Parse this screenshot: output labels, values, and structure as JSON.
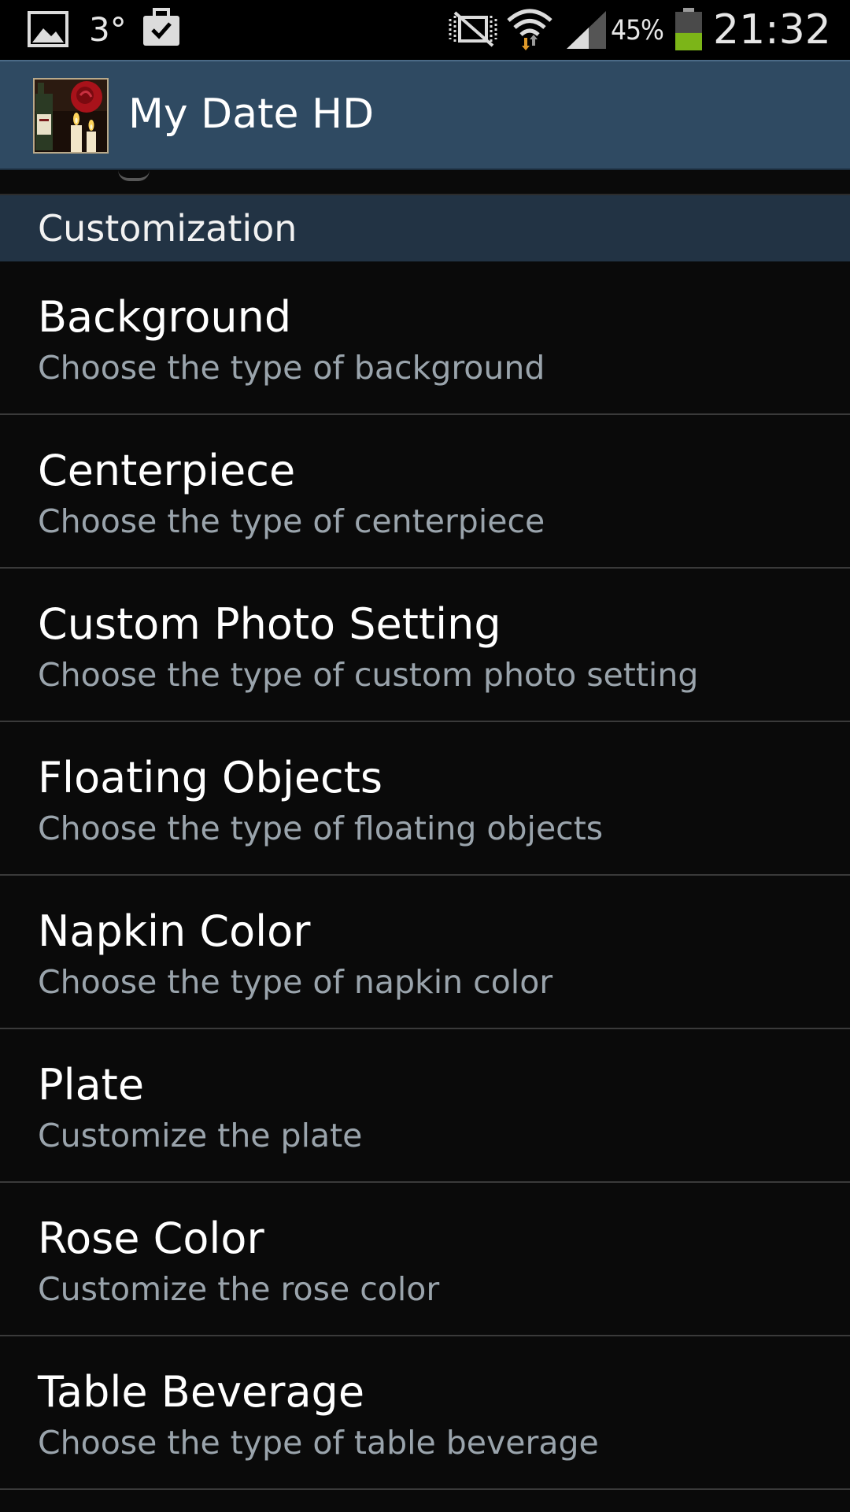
{
  "status_bar": {
    "temperature": "3°",
    "battery_percent": "45%",
    "battery_level": 0.45,
    "time": "21:32",
    "icons": [
      "gallery-icon",
      "briefcase-check-icon",
      "nfc-muted-icon",
      "wifi-icon",
      "signal-icon",
      "battery-icon"
    ]
  },
  "action_bar": {
    "title": "My Date HD",
    "icon": "app-icon-wine-rose-candles"
  },
  "list": {
    "category_title": "Customization",
    "items": [
      {
        "title": "Background",
        "summary": "Choose the type of background"
      },
      {
        "title": "Centerpiece",
        "summary": "Choose the type of centerpiece"
      },
      {
        "title": "Custom Photo Setting",
        "summary": "Choose the type of custom photo setting"
      },
      {
        "title": "Floating Objects",
        "summary": "Choose the type of floating objects"
      },
      {
        "title": "Napkin Color",
        "summary": "Choose the type of napkin color"
      },
      {
        "title": "Plate",
        "summary": "Customize the plate"
      },
      {
        "title": "Rose Color",
        "summary": "Customize the rose color"
      },
      {
        "title": "Table Beverage",
        "summary": "Choose the type of table beverage"
      }
    ]
  },
  "colors": {
    "action_bar": "#2f4a62",
    "category_header": "#223344",
    "summary_text": "#9aa4ac",
    "battery_fill": "#7cb518"
  }
}
